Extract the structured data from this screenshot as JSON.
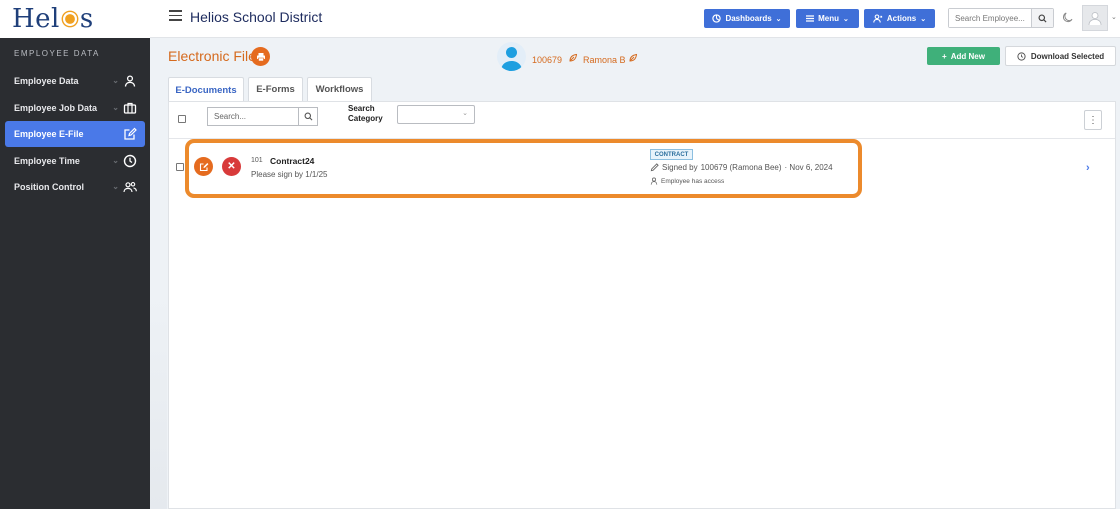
{
  "logo": {
    "text_left": "Hel",
    "text_right": "s"
  },
  "sidebar": {
    "section_title": "EMPLOYEE DATA",
    "items": [
      {
        "label": "Employee Data",
        "icon": "person-icon",
        "active": false
      },
      {
        "label": "Employee Job Data",
        "icon": "briefcase-icon",
        "active": false
      },
      {
        "label": "Employee E-File",
        "icon": "edit-icon",
        "active": true
      },
      {
        "label": "Employee Time",
        "icon": "clock-icon",
        "active": false
      },
      {
        "label": "Position Control",
        "icon": "people-icon",
        "active": false
      }
    ]
  },
  "header": {
    "title": "Helios School District",
    "dashboards_label": "Dashboards",
    "menu_label": "Menu",
    "actions_label": "Actions",
    "search_placeholder": "Search Employee..."
  },
  "page": {
    "title": "Electronic File",
    "employee_id": "100679",
    "employee_name": "Ramona B",
    "add_new_label": "Add New",
    "download_label": "Download Selected"
  },
  "tabs": [
    {
      "label": "E-Documents",
      "active": true
    },
    {
      "label": "E-Forms",
      "active": false
    },
    {
      "label": "Workflows",
      "active": false
    }
  ],
  "toolbar": {
    "search_placeholder": "Search...",
    "category_label_line1": "Search",
    "category_label_line2": "Category",
    "category_value": ""
  },
  "documents": [
    {
      "id": "101",
      "name": "Contract24",
      "note": "Please sign by 1/1/25",
      "badge": "CONTRACT",
      "signed_prefix": "Signed by",
      "signed_by": "100679 (Ramona Bee)",
      "signed_date": "· Nov 6, 2024",
      "access": "Employee has access"
    }
  ],
  "colors": {
    "accent": "#4a79e8",
    "brand_orange": "#e56b1f",
    "danger": "#d83a3a",
    "success": "#3fb07a",
    "sidebar": "#2b2d31"
  }
}
